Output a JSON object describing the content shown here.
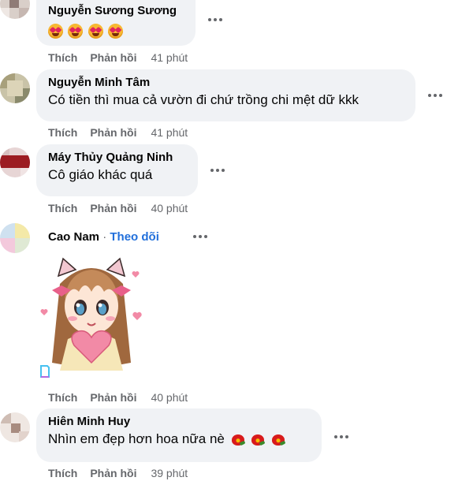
{
  "comments": [
    {
      "author": "Nguyễn Sương Sương",
      "text": "",
      "emoji": [
        "heart-eyes-emoji",
        "heart-eyes-emoji",
        "heart-eyes-emoji",
        "heart-eyes-emoji"
      ],
      "like_label": "Thích",
      "reply_label": "Phản hồi",
      "time": "41 phút"
    },
    {
      "author": "Nguyễn Minh Tâm",
      "text": "Có tiền thì mua cả vườn đi chứ trồng chi mệt dữ kkk",
      "like_label": "Thích",
      "reply_label": "Phản hồi",
      "time": "41 phút"
    },
    {
      "author": "Máy Thủy Quảng Ninh",
      "text": "Cô giáo khác quá",
      "like_label": "Thích",
      "reply_label": "Phản hồi",
      "time": "40 phút"
    },
    {
      "author": "Cao Nam",
      "separator": " · ",
      "follow_label": "Theo dõi",
      "sticker": "cat-girl-holding-heart-sticker",
      "like_label": "Thích",
      "reply_label": "Phản hồi",
      "time": "40 phút"
    },
    {
      "author": "Hiên Minh Huy",
      "text": "Nhìn em đẹp hơn hoa nữa nè",
      "emoji": [
        "hibiscus-emoji",
        "hibiscus-emoji",
        "hibiscus-emoji"
      ],
      "like_label": "Thích",
      "reply_label": "Phản hồi",
      "time": "39 phút"
    }
  ],
  "colors": {
    "bubble": "#f0f2f5",
    "meta": "#65676b",
    "link": "#216fdb",
    "text": "#050505"
  }
}
